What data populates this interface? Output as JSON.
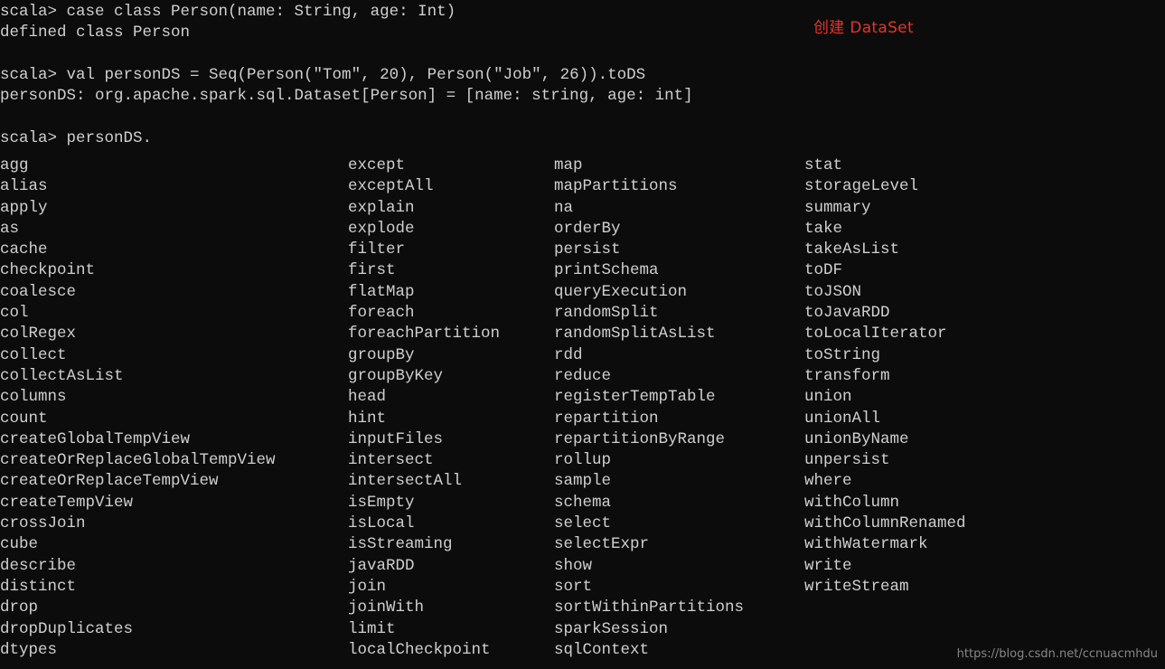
{
  "terminal": {
    "background_color": "#0c0c0c",
    "text_color": "#cfcfcf",
    "transcript": [
      "scala> case class Person(name: String, age: Int)",
      "defined class Person",
      "",
      "scala> val personDS = Seq(Person(\"Tom\", 20), Person(\"Job\", 26)).toDS",
      "personDS: org.apache.spark.sql.Dataset[Person] = [name: string, age: int]",
      "",
      "scala> personDS."
    ]
  },
  "annotation": {
    "text": "创建 DataSet",
    "color": "#e8332a"
  },
  "completions": {
    "columns": [
      {
        "items": [
          "agg",
          "alias",
          "apply",
          "as",
          "cache",
          "checkpoint",
          "coalesce",
          "col",
          "colRegex",
          "collect",
          "collectAsList",
          "columns",
          "count",
          "createGlobalTempView",
          "createOrReplaceGlobalTempView",
          "createOrReplaceTempView",
          "createTempView",
          "crossJoin",
          "cube",
          "describe",
          "distinct",
          "drop",
          "dropDuplicates",
          "dtypes"
        ]
      },
      {
        "items": [
          "except",
          "exceptAll",
          "explain",
          "explode",
          "filter",
          "first",
          "flatMap",
          "foreach",
          "foreachPartition",
          "groupBy",
          "groupByKey",
          "head",
          "hint",
          "inputFiles",
          "intersect",
          "intersectAll",
          "isEmpty",
          "isLocal",
          "isStreaming",
          "javaRDD",
          "join",
          "joinWith",
          "limit",
          "localCheckpoint"
        ]
      },
      {
        "items": [
          "map",
          "mapPartitions",
          "na",
          "orderBy",
          "persist",
          "printSchema",
          "queryExecution",
          "randomSplit",
          "randomSplitAsList",
          "rdd",
          "reduce",
          "registerTempTable",
          "repartition",
          "repartitionByRange",
          "rollup",
          "sample",
          "schema",
          "select",
          "selectExpr",
          "show",
          "sort",
          "sortWithinPartitions",
          "sparkSession",
          "sqlContext"
        ]
      },
      {
        "items": [
          "stat",
          "storageLevel",
          "summary",
          "take",
          "takeAsList",
          "toDF",
          "toJSON",
          "toJavaRDD",
          "toLocalIterator",
          "toString",
          "transform",
          "union",
          "unionAll",
          "unionByName",
          "unpersist",
          "where",
          "withColumn",
          "withColumnRenamed",
          "withWatermark",
          "write",
          "writeStream"
        ]
      }
    ]
  },
  "watermark": {
    "text": "https://blog.csdn.net/ccnuacmhdu"
  }
}
